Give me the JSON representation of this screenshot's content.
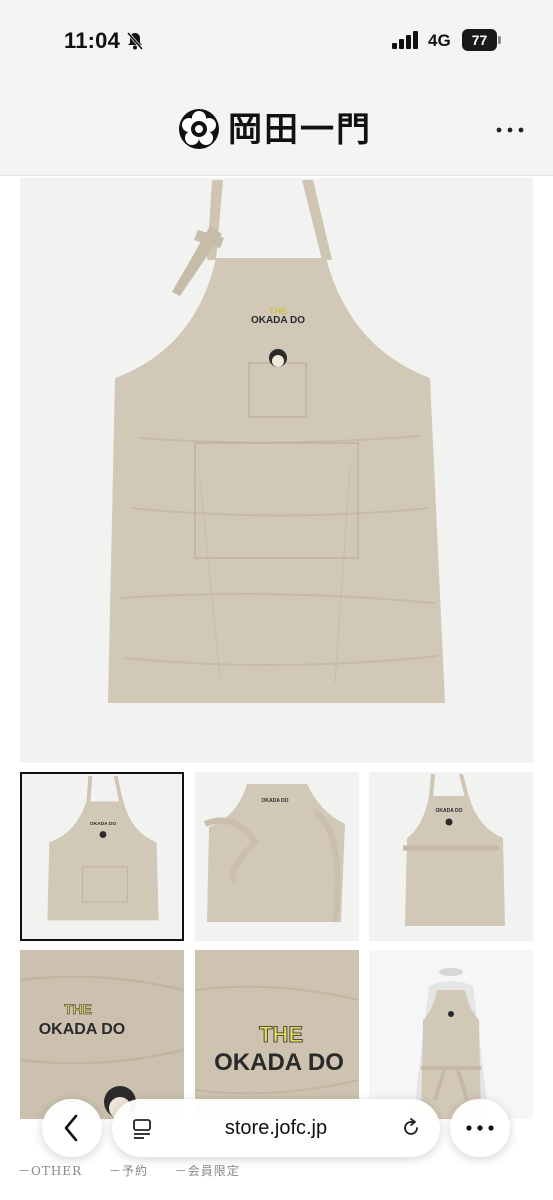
{
  "status_bar": {
    "time": "11:04",
    "network": "4G",
    "battery": "77",
    "icons": [
      "bell-off-icon",
      "cellular-signal-icon",
      "battery-icon"
    ]
  },
  "header": {
    "logo_text": "岡田一門",
    "menu_icon": "more-dots-icon"
  },
  "product": {
    "embroidery_line1": "THE",
    "embroidery_line2": "OKADA DO",
    "fabric_color": "#d2c8b7",
    "thumbnails": [
      {
        "name": "thumb-apron-front",
        "selected": true
      },
      {
        "name": "thumb-apron-side",
        "selected": false
      },
      {
        "name": "thumb-apron-back",
        "selected": false
      },
      {
        "name": "thumb-logo-closeup",
        "selected": false
      },
      {
        "name": "thumb-logo-detail",
        "selected": false
      },
      {
        "name": "thumb-apron-worn",
        "selected": false
      }
    ]
  },
  "footer_links": [
    "－OTHER",
    "－予約",
    "－会員限定"
  ],
  "browser": {
    "url": "store.jofc.jp",
    "back_icon": "chevron-left-icon",
    "reader_icon": "page-menu-icon",
    "reload_icon": "reload-icon",
    "more_icon": "more-dots-icon"
  },
  "colors": {
    "linen": "#d2c8b7",
    "embroidery_yellow": "#e8e05a",
    "embroidery_dark": "#2a2a2a"
  }
}
